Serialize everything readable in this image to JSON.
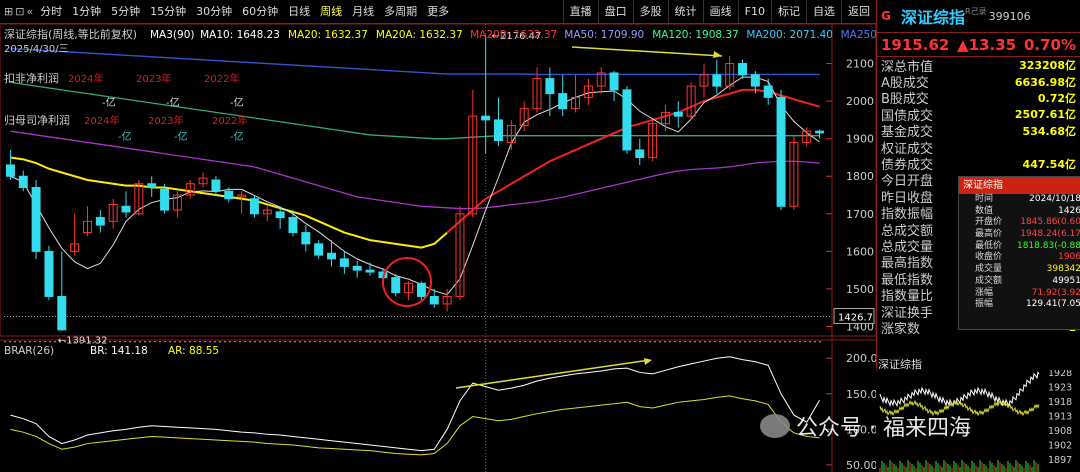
{
  "toolbar": {
    "left_icons": [
      "⊞",
      "⊡",
      "«"
    ],
    "timeframes": [
      "分时",
      "1分钟",
      "5分钟",
      "15分钟",
      "30分钟",
      "60分钟",
      "日线",
      "周线",
      "月线",
      "多周期",
      "更多"
    ],
    "active": "周线",
    "right_buttons": [
      "直播",
      "盘口",
      "多股",
      "统计",
      "画线",
      "F10",
      "标记",
      "自选",
      "返回"
    ]
  },
  "chart": {
    "title": "深证综指(周线,等比前复权)",
    "ma_items": [
      {
        "text": "MA3(90)",
        "color": "#ffffff"
      },
      {
        "text": "MA10: 1648.23",
        "color": "#ffffff"
      },
      {
        "text": "MA20: 1632.37",
        "color": "#ffff00"
      },
      {
        "text": "MA20A: 1632.37",
        "color": "#ffff00"
      },
      {
        "text": "MA20B: 1632.37",
        "color": "#ff3333"
      },
      {
        "text": "MA50: 1709.90",
        "color": "#9999ff"
      },
      {
        "text": "MA120: 1908.37",
        "color": "#33ff99"
      },
      {
        "text": "MA200: 2071.40",
        "color": "#33ccff"
      },
      {
        "text": "MA250: 204",
        "color": "#5577ff"
      }
    ],
    "date": "2025/4/30/三",
    "kf_label": "扣非净利润",
    "kf_years": [
      "2024年",
      "2023年",
      "2022年"
    ],
    "kf_vals": [
      "-亿",
      "-亿",
      "-亿"
    ],
    "gm_label": "归母司净利润",
    "gm_years": [
      "2024年",
      "2023年",
      "2022年"
    ],
    "gm_vals": [
      "-亿",
      "-亿",
      "-亿"
    ],
    "y_ticks": [
      2100,
      2000,
      1900,
      1800,
      1700,
      1600,
      1500,
      1400
    ],
    "high_label": "2176.47",
    "low_label": "1391.32",
    "cursor_price": "1426.7",
    "indicator_label": "BRAR(26)",
    "br_label": "BR: 141.18",
    "ar_label": "AR: 88.55",
    "ind_ticks": [
      "200.0",
      "150.0",
      "100.0",
      "50.00"
    ]
  },
  "chart_data": {
    "type": "candlestick",
    "title": "深证综指(周线,等比前复权)",
    "ylim": [
      1380,
      2200
    ],
    "candles": [
      [
        1830,
        1870,
        1800,
        1790
      ],
      [
        1800,
        1815,
        1770,
        1760
      ],
      [
        1770,
        1790,
        1600,
        1580
      ],
      [
        1600,
        1615,
        1480,
        1470
      ],
      [
        1480,
        1600,
        1391,
        1390
      ],
      [
        1600,
        1700,
        1620,
        1590
      ],
      [
        1650,
        1720,
        1680,
        1640
      ],
      [
        1690,
        1710,
        1670,
        1650
      ],
      [
        1680,
        1740,
        1725,
        1660
      ],
      [
        1720,
        1760,
        1705,
        1690
      ],
      [
        1700,
        1790,
        1780,
        1695
      ],
      [
        1780,
        1800,
        1770,
        1745
      ],
      [
        1765,
        1780,
        1710,
        1700
      ],
      [
        1710,
        1760,
        1750,
        1690
      ],
      [
        1750,
        1790,
        1780,
        1740
      ],
      [
        1780,
        1810,
        1795,
        1770
      ],
      [
        1790,
        1800,
        1760,
        1750
      ],
      [
        1760,
        1770,
        1740,
        1730
      ],
      [
        1745,
        1760,
        1750,
        1700
      ],
      [
        1740,
        1750,
        1700,
        1690
      ],
      [
        1700,
        1720,
        1710,
        1680
      ],
      [
        1705,
        1720,
        1690,
        1660
      ],
      [
        1690,
        1710,
        1650,
        1640
      ],
      [
        1650,
        1670,
        1620,
        1600
      ],
      [
        1620,
        1630,
        1590,
        1580
      ],
      [
        1595,
        1630,
        1580,
        1560
      ],
      [
        1580,
        1600,
        1560,
        1540
      ],
      [
        1560,
        1575,
        1550,
        1530
      ],
      [
        1550,
        1570,
        1545,
        1535
      ],
      [
        1545,
        1555,
        1530,
        1520
      ],
      [
        1530,
        1540,
        1490,
        1480
      ],
      [
        1490,
        1520,
        1515,
        1470
      ],
      [
        1515,
        1520,
        1480,
        1470
      ],
      [
        1480,
        1500,
        1460,
        1450
      ],
      [
        1460,
        1500,
        1480,
        1440
      ],
      [
        1480,
        1720,
        1700,
        1470
      ],
      [
        1700,
        2030,
        1960,
        1690
      ],
      [
        1960,
        2176.47,
        1950,
        1860
      ],
      [
        1950,
        2010,
        1895,
        1880
      ],
      [
        1890,
        1950,
        1935,
        1870
      ],
      [
        1935,
        2000,
        1980,
        1920
      ],
      [
        1980,
        2090,
        2060,
        1970
      ],
      [
        2060,
        2090,
        2020,
        1960
      ],
      [
        2020,
        2070,
        1980,
        1960
      ],
      [
        1980,
        2070,
        2010,
        1970
      ],
      [
        2010,
        2060,
        2040,
        1990
      ],
      [
        2040,
        2090,
        2075,
        2020
      ],
      [
        2075,
        2080,
        2030,
        2000
      ],
      [
        2030,
        2040,
        1870,
        1860
      ],
      [
        1870,
        1900,
        1850,
        1830
      ],
      [
        1850,
        1950,
        1940,
        1840
      ],
      [
        1940,
        1990,
        1970,
        1920
      ],
      [
        1970,
        2000,
        1960,
        1930
      ],
      [
        1960,
        2050,
        2040,
        1950
      ],
      [
        2040,
        2100,
        2070,
        2010
      ],
      [
        2070,
        2110,
        2040,
        2020
      ],
      [
        2040,
        2120,
        2100,
        2030
      ],
      [
        2100,
        2110,
        2070,
        2060
      ],
      [
        2070,
        2080,
        2040,
        2020
      ],
      [
        2040,
        2060,
        2010,
        1990
      ],
      [
        2010,
        2030,
        1720,
        1710
      ],
      [
        1720,
        1910,
        1890,
        1710
      ],
      [
        1890,
        1930,
        1920,
        1880
      ],
      [
        1920,
        1925,
        1915.62,
        1900
      ]
    ],
    "ma20": [
      1850,
      1845,
      1835,
      1820,
      1810,
      1800,
      1790,
      1785,
      1780,
      1775,
      1775,
      1770,
      1770,
      1765,
      1760,
      1755,
      1750,
      1745,
      1740,
      1735,
      1725,
      1715,
      1705,
      1695,
      1680,
      1665,
      1650,
      1640,
      1630,
      1625,
      1620,
      1615,
      1610,
      1620,
      1650,
      1680,
      1710,
      1740,
      1760,
      1780,
      1800,
      1820,
      1840,
      1855,
      1870,
      1885,
      1900,
      1915,
      1930,
      1940,
      1950,
      1960,
      1970,
      1985,
      2000,
      2010,
      2020,
      2030,
      2030,
      2025,
      2015,
      2005,
      1995,
      1985
    ],
    "ma50": [
      1920,
      1915,
      1910,
      1905,
      1900,
      1895,
      1890,
      1885,
      1880,
      1875,
      1870,
      1865,
      1860,
      1855,
      1850,
      1845,
      1840,
      1835,
      1830,
      1825,
      1815,
      1805,
      1795,
      1785,
      1775,
      1765,
      1755,
      1745,
      1740,
      1735,
      1730,
      1725,
      1720,
      1718,
      1716,
      1714,
      1714,
      1716,
      1720,
      1724,
      1728,
      1732,
      1738,
      1744,
      1752,
      1760,
      1768,
      1776,
      1784,
      1792,
      1800,
      1808,
      1814,
      1818,
      1820,
      1822,
      1825,
      1830,
      1835,
      1838,
      1840,
      1840,
      1838,
      1835
    ],
    "ma120": [
      2050,
      2045,
      2040,
      2035,
      2030,
      2025,
      2020,
      2015,
      2010,
      2005,
      2000,
      1995,
      1990,
      1985,
      1980,
      1975,
      1970,
      1965,
      1960,
      1955,
      1950,
      1945,
      1940,
      1935,
      1930,
      1925,
      1920,
      1915,
      1910,
      1908,
      1906,
      1904,
      1902,
      1900,
      1900,
      1902,
      1904,
      1906,
      1908,
      1908,
      1908,
      1908,
      1908,
      1908,
      1908,
      1908,
      1908,
      1908,
      1908,
      1908,
      1908,
      1908,
      1908,
      1908,
      1908,
      1908,
      1908,
      1908,
      1908,
      1908,
      1908,
      1908,
      1908,
      1908
    ],
    "ma200": [
      2140,
      2138,
      2136,
      2134,
      2132,
      2130,
      2128,
      2126,
      2124,
      2122,
      2120,
      2118,
      2116,
      2114,
      2112,
      2110,
      2108,
      2106,
      2104,
      2102,
      2100,
      2098,
      2096,
      2094,
      2092,
      2090,
      2088,
      2086,
      2084,
      2082,
      2080,
      2078,
      2076,
      2074,
      2072,
      2072,
      2072,
      2072,
      2072,
      2072,
      2072,
      2071,
      2071,
      2071,
      2071,
      2071,
      2071,
      2071,
      2071,
      2071,
      2071,
      2071,
      2071,
      2071,
      2071,
      2071,
      2071,
      2071,
      2071,
      2071,
      2071,
      2071,
      2071,
      2071
    ],
    "br": [
      120,
      115,
      108,
      90,
      80,
      85,
      92,
      95,
      98,
      100,
      103,
      105,
      104,
      103,
      102,
      101,
      100,
      98,
      96,
      95,
      93,
      92,
      90,
      88,
      86,
      84,
      82,
      80,
      78,
      76,
      74,
      72,
      70,
      72,
      100,
      140,
      165,
      160,
      155,
      158,
      162,
      168,
      172,
      175,
      178,
      180,
      182,
      185,
      186,
      180,
      178,
      183,
      188,
      192,
      196,
      200,
      202,
      198,
      195,
      190,
      150,
      120,
      110,
      141
    ],
    "ar": [
      100,
      96,
      90,
      80,
      72,
      75,
      80,
      82,
      84,
      86,
      88,
      90,
      89,
      88,
      87,
      86,
      85,
      84,
      83,
      82,
      80,
      79,
      78,
      76,
      74,
      73,
      72,
      71,
      70,
      68,
      66,
      65,
      64,
      66,
      80,
      105,
      118,
      115,
      112,
      114,
      118,
      122,
      125,
      128,
      130,
      132,
      134,
      136,
      138,
      132,
      130,
      134,
      138,
      140,
      142,
      145,
      147,
      143,
      140,
      135,
      110,
      95,
      90,
      88
    ]
  },
  "info": {
    "g": "G",
    "name": "深证综指",
    "tag": "R己录",
    "code": "399106",
    "price": "1915.62",
    "change": "▲13.35",
    "pct": "0.70%",
    "fields": [
      {
        "l": "深总市值",
        "v": "323208亿"
      },
      {
        "l": "A股成交",
        "v": "6636.98亿"
      },
      {
        "l": "B股成交",
        "v": "0.72亿"
      },
      {
        "l": "国债成交",
        "v": "2507.61亿"
      },
      {
        "l": "基金成交",
        "v": "534.68亿"
      },
      {
        "l": "权证成交",
        "v": ""
      },
      {
        "l": "债券成交",
        "v": "447.54亿"
      },
      {
        "l": "今日开盘",
        "v": ""
      },
      {
        "l": "昨日收盘",
        "v": ""
      },
      {
        "l": "指数振幅",
        "v": ""
      },
      {
        "l": "总成交额",
        "v": ""
      },
      {
        "l": "总成交量",
        "v": ""
      },
      {
        "l": "最高指数",
        "v": ""
      },
      {
        "l": "最低指数",
        "v": ""
      },
      {
        "l": "指数量比",
        "v": ""
      },
      {
        "l": "深证换手",
        "v": ""
      },
      {
        "l": "涨家数",
        "v": "1"
      }
    ],
    "mini_title": "深证综指",
    "mini_ticks": [
      "1928",
      "1923",
      "1918",
      "1913",
      "1908",
      "1902",
      "1897"
    ]
  },
  "popup": {
    "title": "深证综指",
    "rows": [
      {
        "l": "时间",
        "v": "2024/10/18",
        "c": ""
      },
      {
        "l": "数值",
        "v": "1426",
        "c": ""
      },
      {
        "l": "开盘价",
        "v": "1845.86(0.60",
        "c": "red"
      },
      {
        "l": "最高价",
        "v": "1948.24(6.17",
        "c": "red"
      },
      {
        "l": "最低价",
        "v": "1818.83(-0.88",
        "c": "grn"
      },
      {
        "l": "收盘价",
        "v": "1906",
        "c": "red"
      },
      {
        "l": "成交量",
        "v": "398342",
        "c": "yel"
      },
      {
        "l": "成交额",
        "v": "49951",
        "c": ""
      },
      {
        "l": "涨幅",
        "v": "71.92(3.92",
        "c": "red"
      },
      {
        "l": "振幅",
        "v": "129.41(7.05",
        "c": ""
      }
    ]
  },
  "watermark": {
    "text": "公众号 · 福来四海"
  }
}
